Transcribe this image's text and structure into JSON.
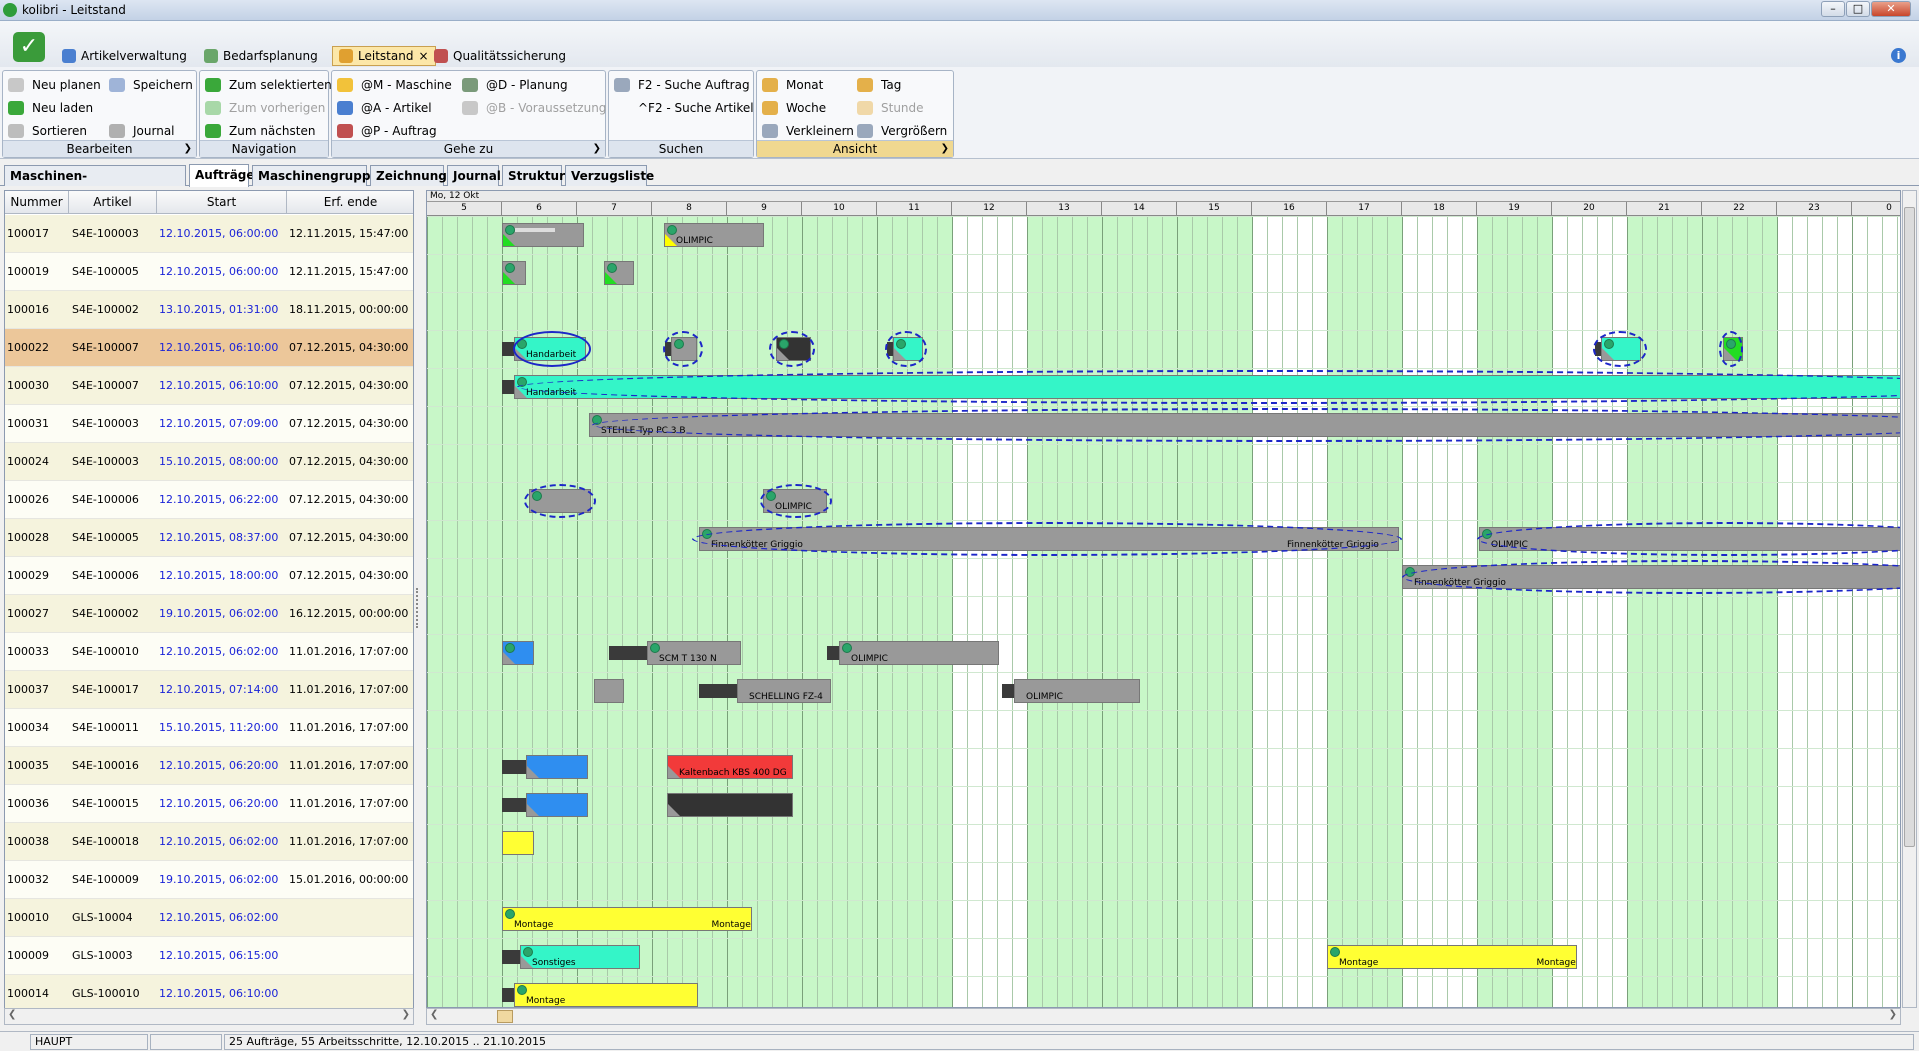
{
  "window": {
    "title": "kolibri - Leitstand",
    "min": "–",
    "max": "□",
    "close": "✕"
  },
  "menu": {
    "tabs": [
      {
        "label": "Artikelverwaltung"
      },
      {
        "label": "Bedarfsplanung"
      },
      {
        "label": "Leitstand",
        "close": "×"
      },
      {
        "label": "Qualitätssicherung"
      }
    ],
    "info": "i"
  },
  "ribbon": {
    "bearbeiten": {
      "caption": "Bearbeiten",
      "neu_planen": "Neu planen",
      "speichern": "Speichern",
      "neu_laden": "Neu laden",
      "sortieren": "Sortieren",
      "journal": "Journal"
    },
    "navigation": {
      "caption": "Navigation",
      "zum_selektierten": "Zum selektierten",
      "zum_vorherigen": "Zum vorherigen",
      "zum_naechsten": "Zum nächsten"
    },
    "gehezu": {
      "caption": "Gehe zu",
      "maschine": "@M - Maschine",
      "artikel": "@A - Artikel",
      "auftrag": "@P - Auftrag",
      "planung": "@D - Planung",
      "voraussetzung": "@B - Voraussetzung"
    },
    "suchen": {
      "caption": "Suchen",
      "auftrag": "F2 - Suche Auftrag",
      "artikel": "^F2 - Suche Artikel"
    },
    "ansicht": {
      "caption": "Ansicht",
      "monat": "Monat",
      "tag": "Tag",
      "woche": "Woche",
      "stunde": "Stunde",
      "verkleinern": "Verkleinern",
      "vergroessern": "Vergrößern"
    }
  },
  "page_tabs": [
    "Maschinen-Auftragsverteilung",
    "Aufträge",
    "Maschinengruppe",
    "Zeichnung",
    "Journal",
    "Struktur",
    "Verzugsliste"
  ],
  "grid": {
    "headers": [
      "Nummer",
      "Artikel",
      "Start",
      "Erf. ende"
    ],
    "rows": [
      [
        "100017",
        "S4E-100003",
        "12.10.2015, 06:00:00",
        "12.11.2015, 15:47:00"
      ],
      [
        "100019",
        "S4E-100005",
        "12.10.2015, 06:00:00",
        "12.11.2015, 15:47:00"
      ],
      [
        "100016",
        "S4E-100002",
        "13.10.2015, 01:31:00",
        "18.11.2015, 00:00:00"
      ],
      [
        "100022",
        "S4E-100007",
        "12.10.2015, 06:10:00",
        "07.12.2015, 04:30:00"
      ],
      [
        "100030",
        "S4E-100007",
        "12.10.2015, 06:10:00",
        "07.12.2015, 04:30:00"
      ],
      [
        "100031",
        "S4E-100003",
        "12.10.2015, 07:09:00",
        "07.12.2015, 04:30:00"
      ],
      [
        "100024",
        "S4E-100003",
        "15.10.2015, 08:00:00",
        "07.12.2015, 04:30:00"
      ],
      [
        "100026",
        "S4E-100006",
        "12.10.2015, 06:22:00",
        "07.12.2015, 04:30:00"
      ],
      [
        "100028",
        "S4E-100005",
        "12.10.2015, 08:37:00",
        "07.12.2015, 04:30:00"
      ],
      [
        "100029",
        "S4E-100006",
        "12.10.2015, 18:00:00",
        "07.12.2015, 04:30:00"
      ],
      [
        "100027",
        "S4E-100002",
        "19.10.2015, 06:02:00",
        "16.12.2015, 00:00:00"
      ],
      [
        "100033",
        "S4E-100010",
        "12.10.2015, 06:02:00",
        "11.01.2016, 17:07:00"
      ],
      [
        "100037",
        "S4E-100017",
        "12.10.2015, 07:14:00",
        "11.01.2016, 17:07:00"
      ],
      [
        "100034",
        "S4E-100011",
        "15.10.2015, 11:20:00",
        "11.01.2016, 17:07:00"
      ],
      [
        "100035",
        "S4E-100016",
        "12.10.2015, 06:20:00",
        "11.01.2016, 17:07:00"
      ],
      [
        "100036",
        "S4E-100015",
        "12.10.2015, 06:20:00",
        "11.01.2016, 17:07:00"
      ],
      [
        "100038",
        "S4E-100018",
        "12.10.2015, 06:02:00",
        "11.01.2016, 17:07:00"
      ],
      [
        "100032",
        "S4E-100009",
        "19.10.2015, 06:02:00",
        "15.01.2016, 00:00:00"
      ],
      [
        "100010",
        "GLS-10004",
        "12.10.2015, 06:02:00",
        ""
      ],
      [
        "100009",
        "GLS-10003",
        "12.10.2015, 06:15:00",
        ""
      ],
      [
        "100014",
        "GLS-100010",
        "12.10.2015, 06:10:00",
        ""
      ]
    ]
  },
  "gantt": {
    "day_label": "Mo, 12 Okt",
    "hours": [
      "5",
      "6",
      "7",
      "8",
      "9",
      "10",
      "11",
      "12",
      "13",
      "14",
      "15",
      "16",
      "17",
      "18",
      "19",
      "20",
      "21",
      "22",
      "23",
      "0"
    ],
    "labels": {
      "olimpic": "OLIMPIC",
      "handarbeit": "Handarbeit",
      "stehle": "STEHLE Typ PC 3 B",
      "finnenkoetter": "Finnenkötter Griggio",
      "scm": "SCM T 130 N",
      "schelling": "SCHELLING FZ-4",
      "kaltenbach": "Kaltenbach KBS 400 DG",
      "montage": "Montage",
      "sonstiges": "Sonstiges"
    },
    "colors": {
      "grey": "#999999",
      "cyan": "#34f5c8",
      "blue": "#2f8ef0",
      "red": "#f23a3a",
      "yellow": "#ffff33",
      "dark": "#333333",
      "green": "#22dd22"
    }
  },
  "status": {
    "mode": "HAUPT",
    "empty": "",
    "summary": "25 Aufträge, 55 Arbeitsschritte, 12.10.2015 .. 21.10.2015"
  }
}
